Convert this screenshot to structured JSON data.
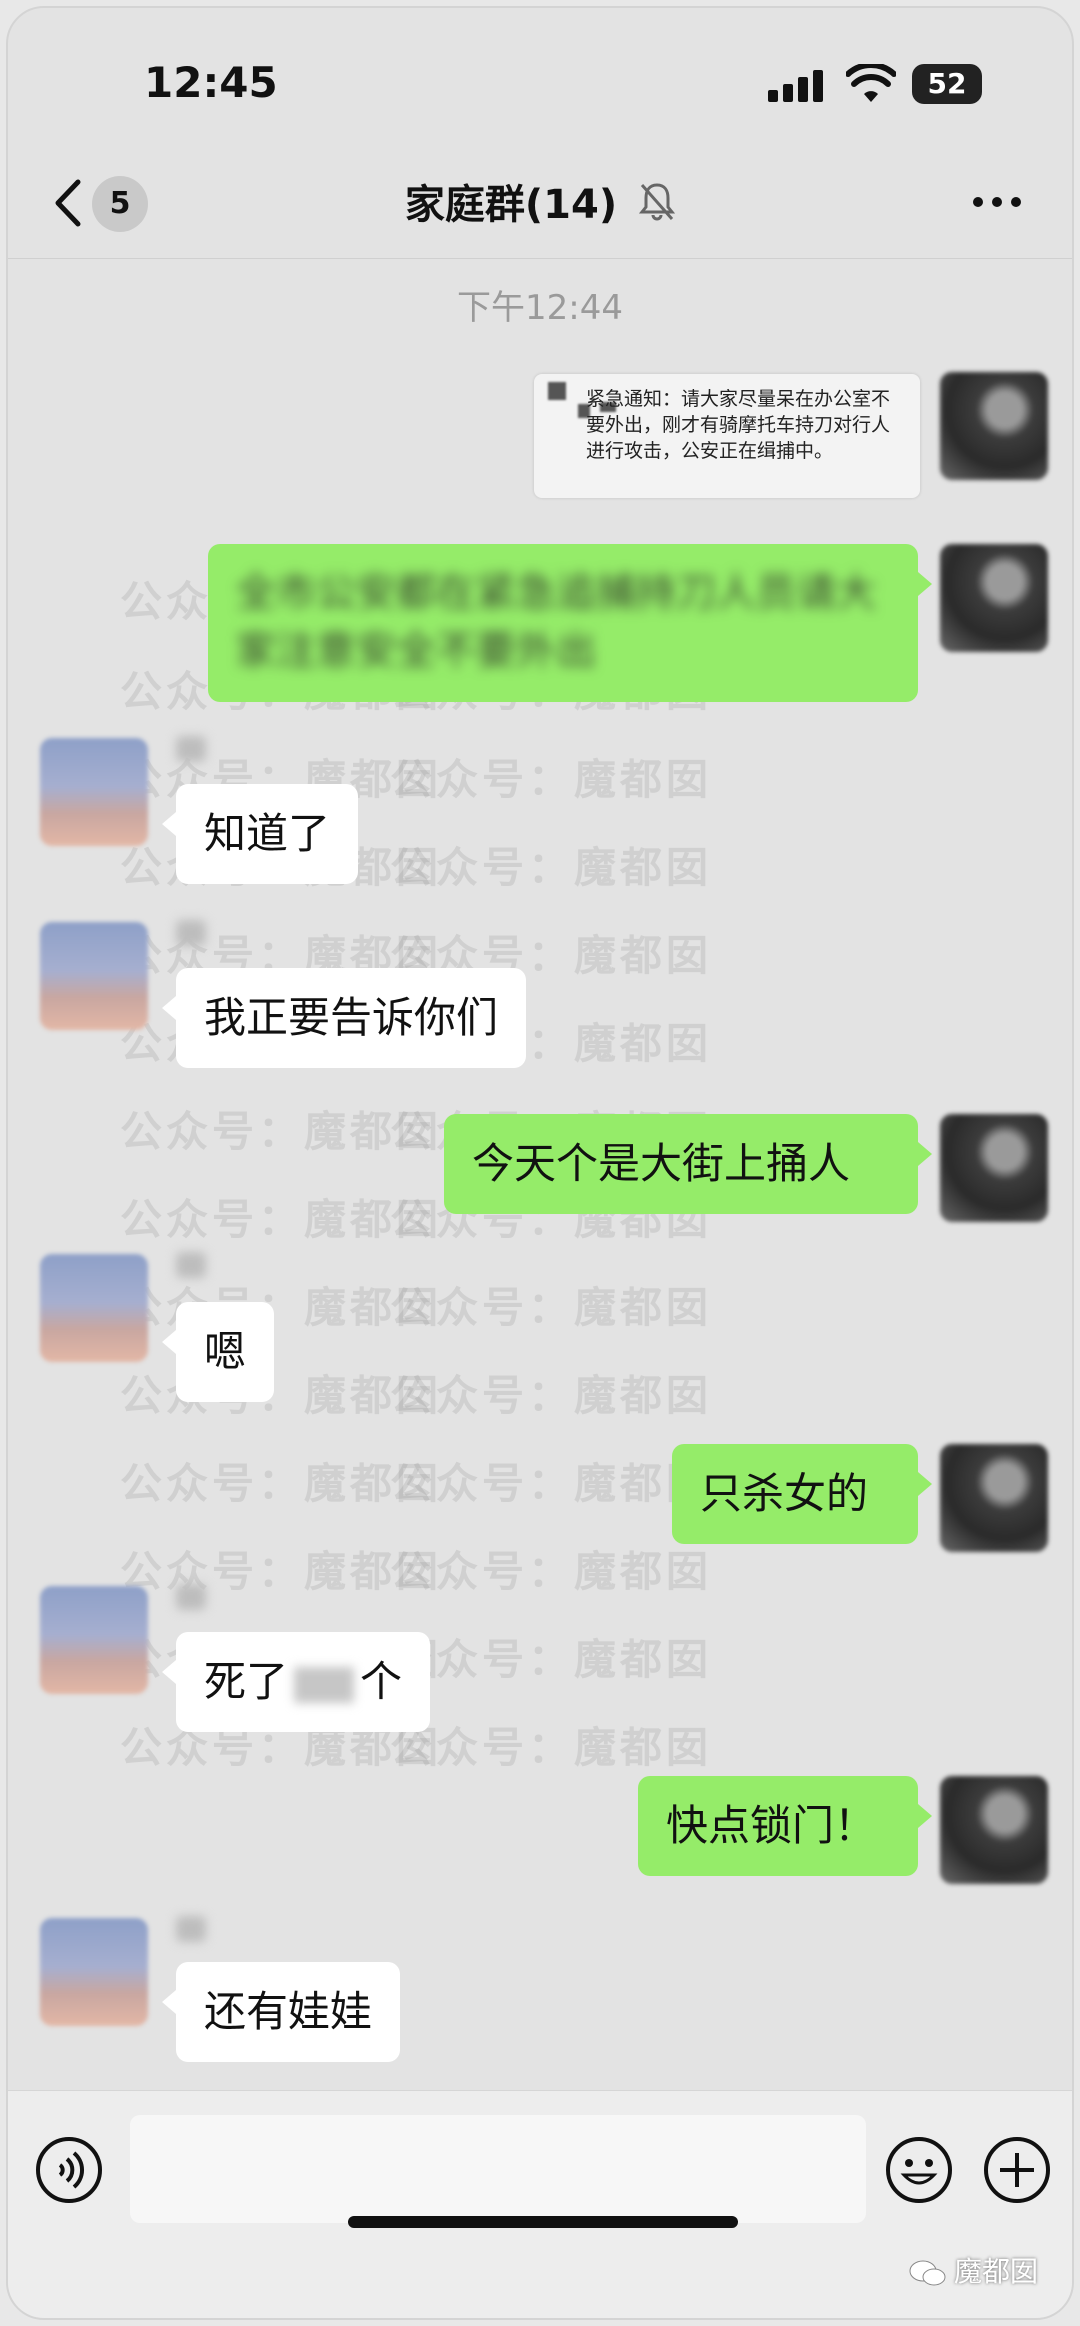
{
  "status_bar": {
    "time": "12:45",
    "battery": "52"
  },
  "header": {
    "back_count": "5",
    "title": "家庭群(14)"
  },
  "timestamp": "下午12:44",
  "watermark_text": "公众号：魔都囡",
  "brand_watermark": "魔都囡",
  "messages": {
    "notice_text": "紧急通知：请大家尽量呆在办公室不要外出，刚才有骑摩托车持刀对行人进行攻击，公安正在缉捕中。",
    "blurred_text": "全市公安都在紧急追捕持刀人员请大家注意安全不要外出",
    "m1": "知道了",
    "m2": "我正要告诉你们",
    "m3": "今天个是大街上捅人",
    "m4": "嗯",
    "m5": "只杀女的",
    "m6_pre": "死了",
    "m6_post": "个",
    "m7": "快点锁门！",
    "m8": "还有娃娃"
  }
}
